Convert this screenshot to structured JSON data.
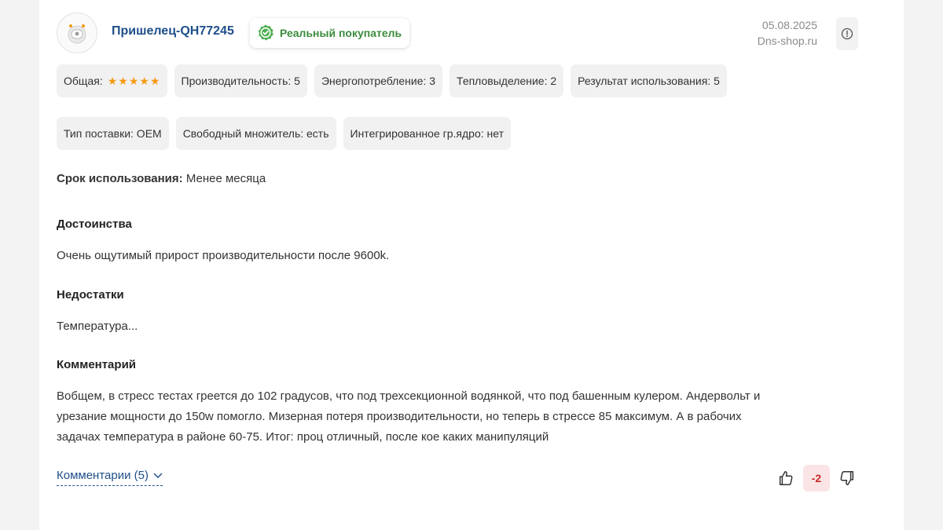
{
  "review": {
    "username": "Пришелец-QH77245",
    "badge_label": "Реальный покупатель",
    "date": "05.08.2025",
    "source": "Dns-shop.ru"
  },
  "ratings": {
    "overall_label": "Общая:",
    "overall_stars": 5,
    "items": [
      "Производительность: 5",
      "Энергопотребление: 3",
      "Тепловыделение: 2",
      "Результат использования: 5"
    ]
  },
  "specs": [
    "Тип поставки: OEM",
    "Свободный множитель: есть",
    "Интегрированное гр.ядро: нет"
  ],
  "usage": {
    "label": "Срок использования:",
    "value": "Менее месяца"
  },
  "pros": {
    "title": "Достоинства",
    "text": "Очень ощутимый прирост производительности после 9600k."
  },
  "cons": {
    "title": "Недостатки",
    "text": "Температура..."
  },
  "comment": {
    "title": "Комментарий",
    "lines": [
      "Вобщем, в стресс тестах греется до 102 градусов, что под трехсекционной водянкой, что под башенным кулером. Андервольт и",
      "урезание мощности до 150w помогло. Мизерная потеря производительности, но теперь в стрессе 85 максимум. А в рабочих",
      "задачах температура в районе 60-75. Итог: проц отличный, после кое каких манипуляций"
    ]
  },
  "footer": {
    "comments_link": "Комментарии (5)",
    "score": "-2"
  },
  "colors": {
    "accent_blue": "#1e4f8a",
    "badge_green": "#3d8c3d",
    "star_orange": "#f59a12",
    "negative_red": "#c62828"
  },
  "icons": {
    "badge": "verified-check-icon",
    "report": "info-circle-icon",
    "like": "thumbs-up-icon",
    "dislike": "thumbs-down-icon",
    "expand": "chevron-down-icon"
  }
}
